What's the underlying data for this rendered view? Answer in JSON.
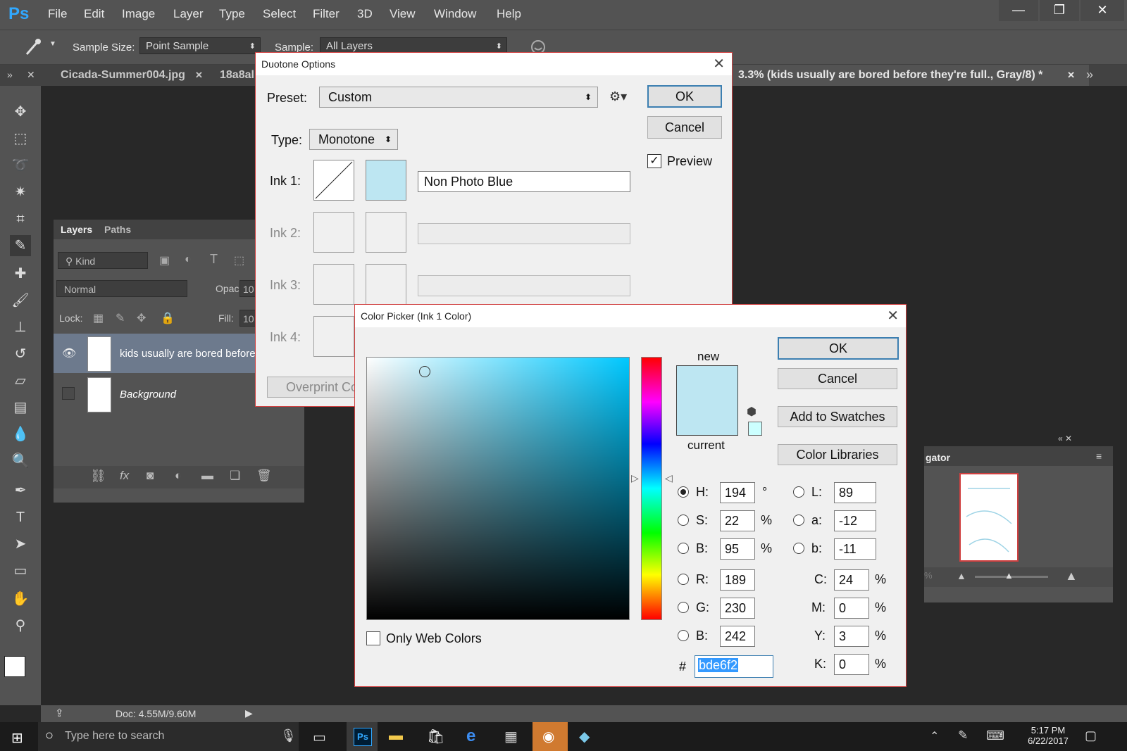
{
  "app": {
    "logo": "Ps"
  },
  "menu": [
    "File",
    "Edit",
    "Image",
    "Layer",
    "Type",
    "Select",
    "Filter",
    "3D",
    "View",
    "Window",
    "Help"
  ],
  "window_controls": {
    "minimize": "—",
    "restore": "❐",
    "close": "✕"
  },
  "options_bar": {
    "sample_size_label": "Sample Size:",
    "sample_size_value": "Point Sample",
    "sample_label": "Sample:",
    "sample_value": "All Layers"
  },
  "tabs": {
    "tab1": "Cicada-Summer004.jpg",
    "tab2": "18a8al",
    "active_doc": "3.3% (kids usually are bored before they're full., Gray/8) *"
  },
  "layers_panel": {
    "tab_layers": "Layers",
    "tab_paths": "Paths",
    "filter_kind": "Kind",
    "blend_mode": "Normal",
    "opacity_label": "Opacity:",
    "opacity_value": "10",
    "lock_label": "Lock:",
    "fill_label": "Fill:",
    "fill_value": "10",
    "layers": [
      {
        "name": "kids usually are bored before",
        "visible": true,
        "selected": true
      },
      {
        "name": "Background",
        "visible": false,
        "selected": false
      }
    ]
  },
  "navigator": {
    "title": "gator",
    "zoom": "%"
  },
  "status": {
    "doc": "Doc: 4.55M/9.60M"
  },
  "duotone": {
    "title": "Duotone Options",
    "preset_label": "Preset:",
    "preset_value": "Custom",
    "type_label": "Type:",
    "type_value": "Monotone",
    "ink1_label": "Ink 1:",
    "ink1_name": "Non Photo Blue",
    "ink1_color": "#bde6f2",
    "ink2_label": "Ink 2:",
    "ink3_label": "Ink 3:",
    "ink4_label": "Ink 4:",
    "overprint_label": "Overprint Co",
    "ok": "OK",
    "cancel": "Cancel",
    "preview_label": "Preview",
    "preview_checked": true
  },
  "picker": {
    "title": "Color Picker (Ink 1 Color)",
    "new_label": "new",
    "current_label": "current",
    "ok": "OK",
    "cancel": "Cancel",
    "add_swatches": "Add to Swatches",
    "color_libraries": "Color Libraries",
    "only_web": "Only Web Colors",
    "hue_color": "#00c8ff",
    "new_color": "#bde6f2",
    "current_color": "#bde6f2",
    "web_safe_color": "#ccffff",
    "hsb": {
      "h_label": "H:",
      "h": "194",
      "h_unit": "°",
      "s_label": "S:",
      "s": "22",
      "s_unit": "%",
      "b_label": "B:",
      "b": "95",
      "b_unit": "%"
    },
    "rgb": {
      "r_label": "R:",
      "r": "189",
      "g_label": "G:",
      "g": "230",
      "b_label": "B:",
      "b": "242"
    },
    "lab": {
      "l_label": "L:",
      "l": "89",
      "a_label": "a:",
      "a": "-12",
      "b_label": "b:",
      "b": "-11"
    },
    "cmyk": {
      "c_label": "C:",
      "c": "24",
      "m_label": "M:",
      "m": "0",
      "y_label": "Y:",
      "y": "3",
      "k_label": "K:",
      "k": "0",
      "unit": "%"
    },
    "hex_label": "#",
    "hex": "bde6f2"
  },
  "taskbar": {
    "search_placeholder": "Type here to search",
    "time": "5:17 PM",
    "date": "6/22/2017"
  }
}
